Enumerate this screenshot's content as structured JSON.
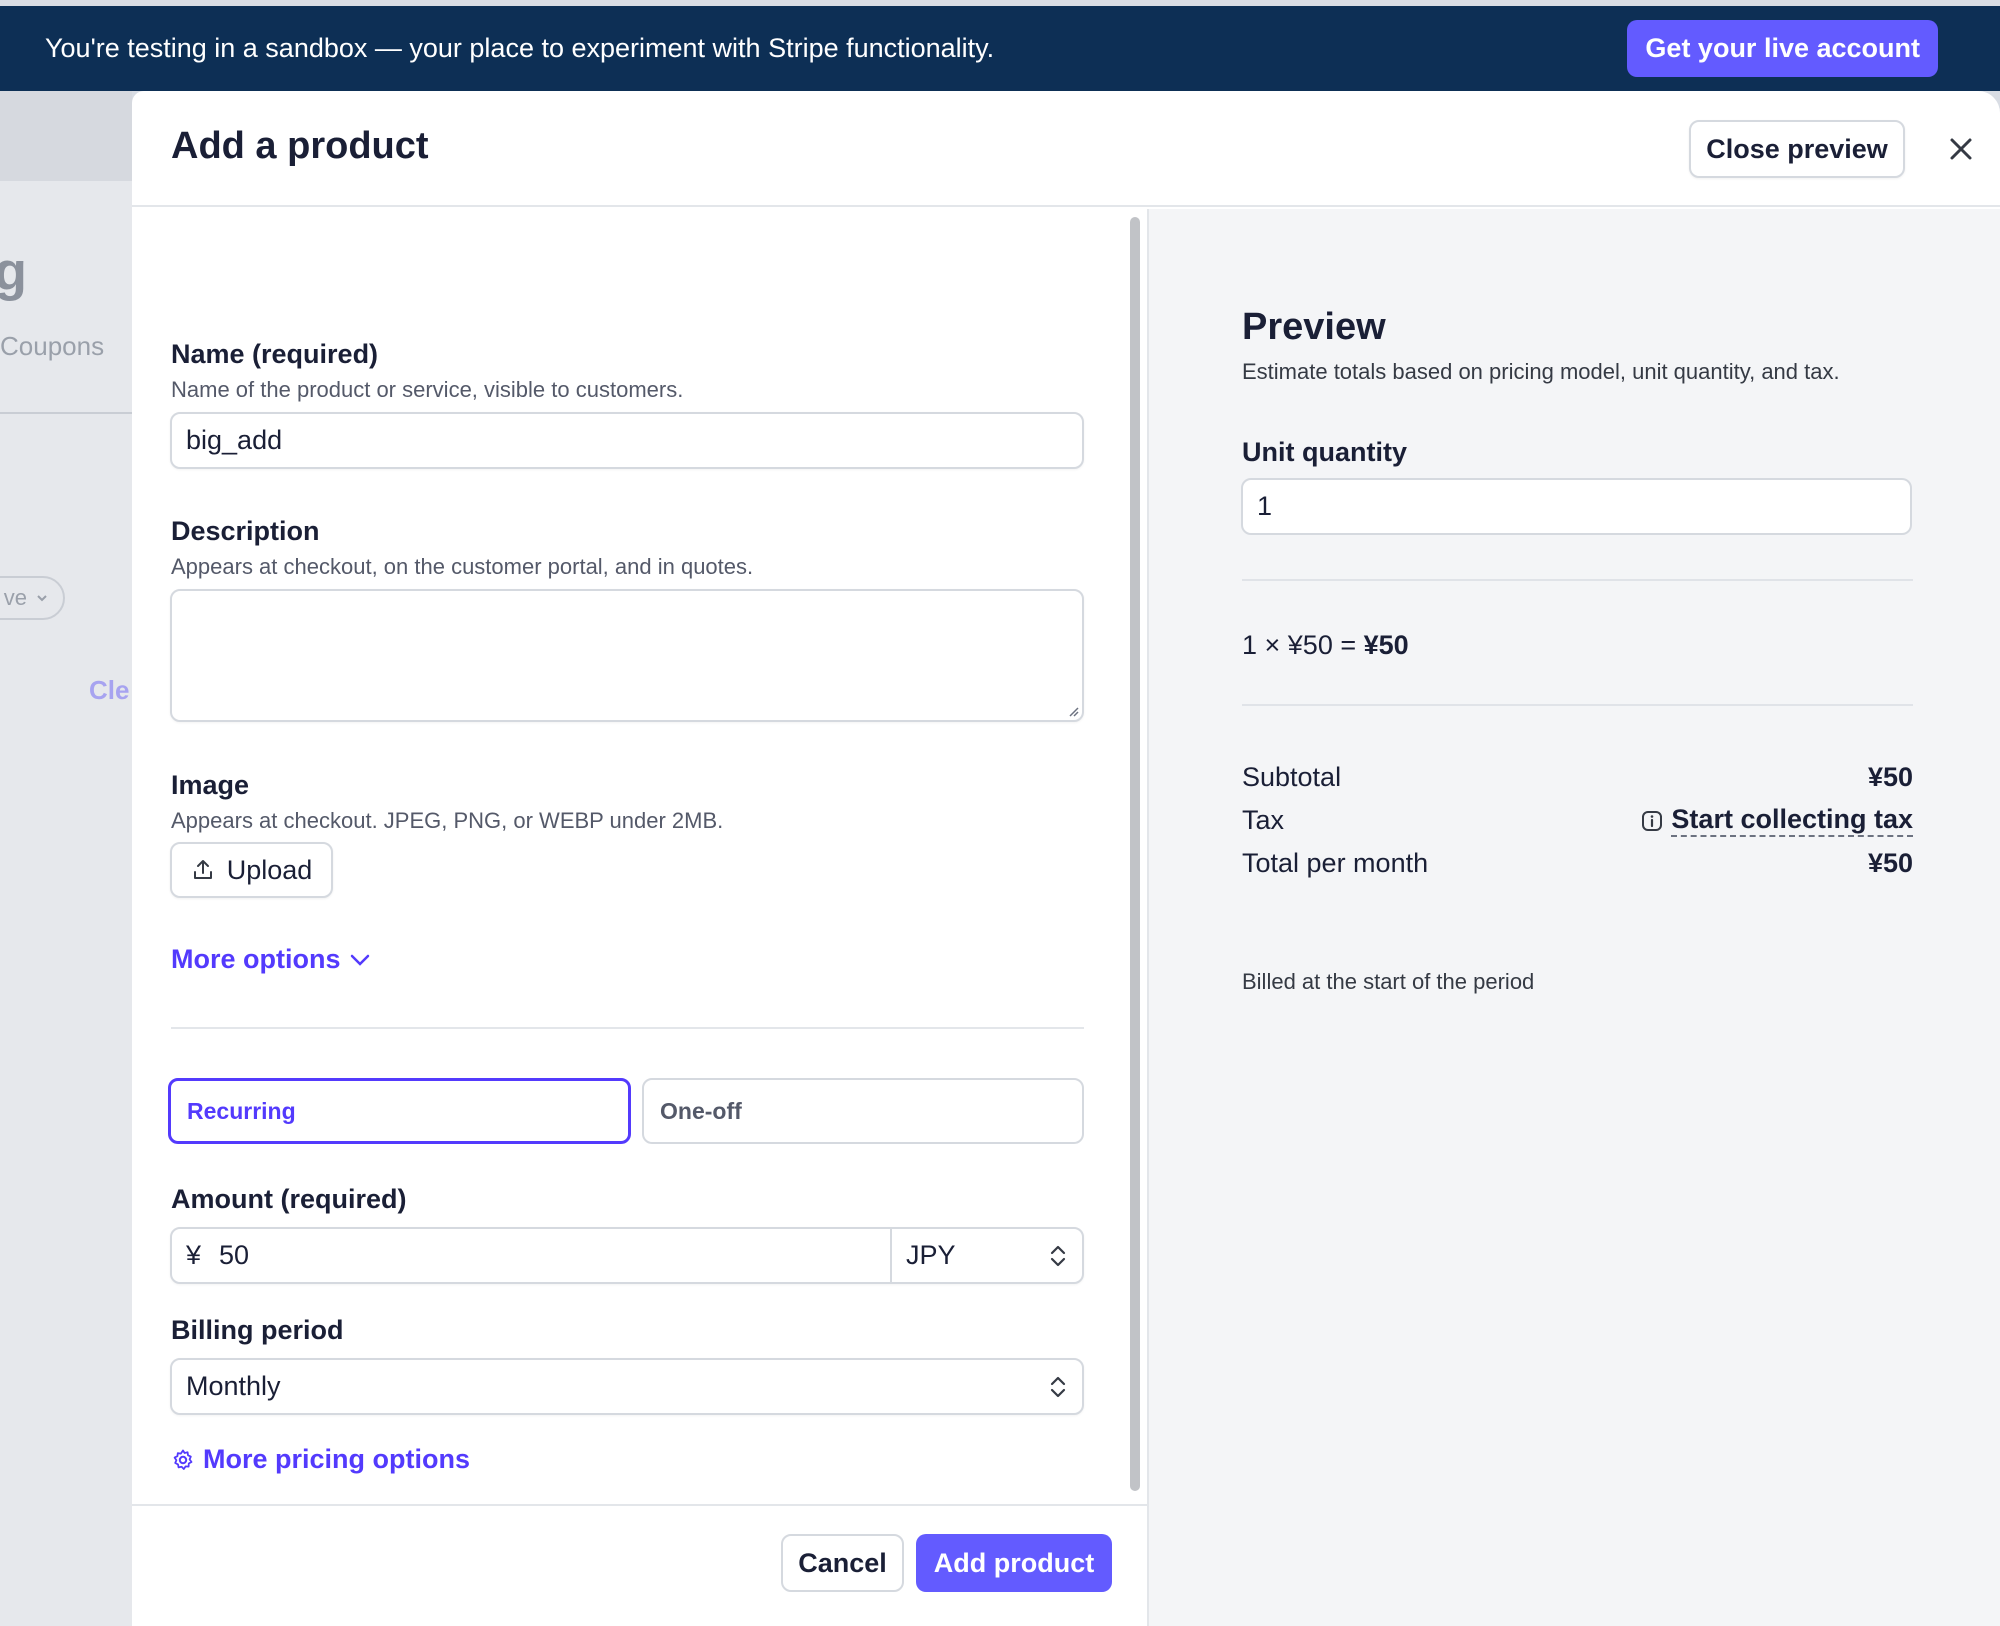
{
  "banner": {
    "text": "You're testing in a sandbox — your place to experiment with Stripe functionality.",
    "cta_label": "Get your live account"
  },
  "background": {
    "title_fragment": "g",
    "tab_fragment": "Coupons",
    "pill_fragment": "ve",
    "link_fragment": "Cle"
  },
  "modal": {
    "title": "Add a product",
    "close_preview_label": "Close preview"
  },
  "form": {
    "name": {
      "label": "Name (required)",
      "help": "Name of the product or service, visible to customers.",
      "value": "big_add"
    },
    "description": {
      "label": "Description",
      "help": "Appears at checkout, on the customer portal, and in quotes.",
      "value": ""
    },
    "image": {
      "label": "Image",
      "help": "Appears at checkout. JPEG, PNG, or WEBP under 2MB.",
      "upload_label": "Upload"
    },
    "more_options_label": "More options",
    "pricing_type": {
      "options": [
        "Recurring",
        "One-off"
      ],
      "selected": "Recurring"
    },
    "amount": {
      "label": "Amount (required)",
      "currency_symbol": "¥",
      "value": "50",
      "currency": "JPY"
    },
    "billing_period": {
      "label": "Billing period",
      "value": "Monthly"
    },
    "more_pricing_options_label": "More pricing options"
  },
  "footer": {
    "cancel_label": "Cancel",
    "submit_label": "Add product"
  },
  "preview": {
    "title": "Preview",
    "subtitle": "Estimate totals based on pricing model, unit quantity, and tax.",
    "unit_quantity_label": "Unit quantity",
    "unit_quantity_value": "1",
    "calc_prefix": "1 × ¥50 = ",
    "calc_total": "¥50",
    "subtotal_label": "Subtotal",
    "subtotal_value": "¥50",
    "tax_label": "Tax",
    "tax_link_label": "Start collecting tax",
    "total_label": "Total per month",
    "total_value": "¥50",
    "billed_note": "Billed at the start of the period"
  },
  "colors": {
    "banner_bg": "#0d2f55",
    "accent": "#635bff",
    "link": "#533afd"
  }
}
